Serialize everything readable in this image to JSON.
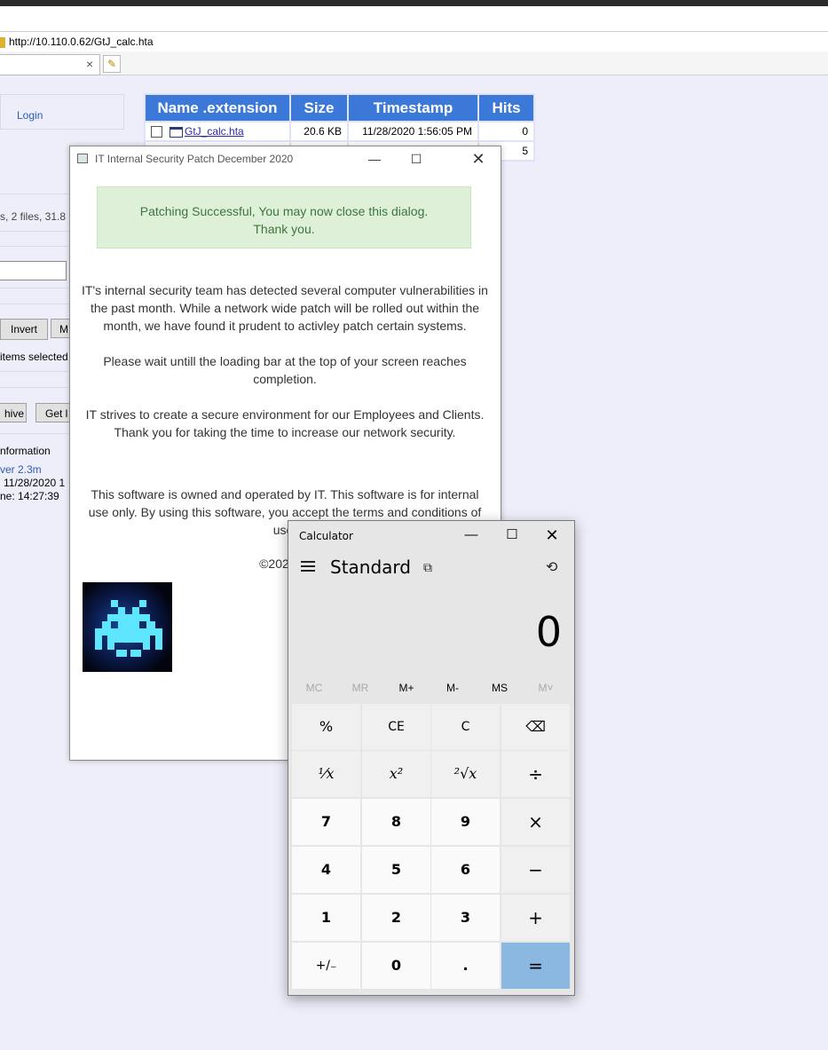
{
  "browser": {
    "url": "http://10.110.0.62/GtJ_calc.hta",
    "tab_close": "×",
    "new_tab_icon": "✎"
  },
  "left_panel": {
    "login": "Login",
    "stats": "s, 2 files, 31.8 I",
    "invert_button": "Invert",
    "m_button": "M",
    "items_selected": "items selected",
    "archive_button": "hive",
    "get_list_button": "Get l",
    "info_title": "nformation",
    "server_link": "ver 2.3m",
    "date_line": "11/28/2020 1",
    "time_line": "ne: 14:27:39"
  },
  "file_table": {
    "headers": [
      "Name .extension",
      "Size",
      "Timestamp",
      "Hits"
    ],
    "rows": [
      {
        "name": "GtJ_calc.hta",
        "size": "20.6 KB",
        "timestamp": "11/28/2020 1:56:05 PM",
        "hits": "0"
      },
      {
        "name": "",
        "size": "",
        "timestamp": "",
        "hits": "5"
      }
    ]
  },
  "hta_dialog": {
    "title": "IT Internal Security Patch December 2020",
    "minimize": "—",
    "maximize": "☐",
    "close": "✕",
    "success_line1": "Patching Successful, You may now close this dialog.",
    "success_line2": "Thank you.",
    "para1": "IT's internal security team has detected several computer vulnerabilities in the past month. While a network wide patch will be rolled out within the month, we have found it prudent to activley patch certain systems.",
    "para2": "Please wait untill the loading bar at the top of your screen reaches completion.",
    "para3": "IT strives to create a secure environment for our Employees and Clients. Thank you for taking the time to increase our network security.",
    "para4": "This software is owned and operated by IT. This software is for internal use only. By using this software, you accept the terms and conditions of use.",
    "copyright": "©2020 IT"
  },
  "calculator": {
    "title": "Calculator",
    "minimize": "—",
    "maximize": "☐",
    "close": "✕",
    "mode": "Standard",
    "keep_on_top_icon": "⧉",
    "history_icon": "⟲",
    "display": "0",
    "memory": [
      "MC",
      "MR",
      "M+",
      "M-",
      "MS",
      "M˅"
    ],
    "keys": [
      [
        "%",
        "CE",
        "C",
        "⌫"
      ],
      [
        "¹⁄x",
        "x²",
        "²√x",
        "÷"
      ],
      [
        "7",
        "8",
        "9",
        "×"
      ],
      [
        "4",
        "5",
        "6",
        "−"
      ],
      [
        "1",
        "2",
        "3",
        "+"
      ],
      [
        "+/₋",
        "0",
        ".",
        "="
      ]
    ]
  }
}
